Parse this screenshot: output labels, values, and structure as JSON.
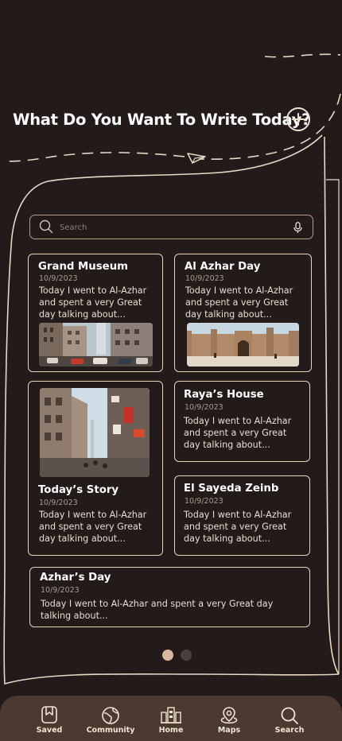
{
  "header": {
    "title": "What Do You Want To Write Today?",
    "add_icon": "plus-circle-icon"
  },
  "search": {
    "placeholder": "Search",
    "value": "",
    "icon": "search-icon",
    "mic_icon": "microphone-icon"
  },
  "cards": [
    {
      "title": "Grand Museum",
      "date": "10/9/2023",
      "text": "Today I went to Al-Azhar and spent a very Great day talking about..."
    },
    {
      "title": "Al Azhar Day",
      "date": "10/9/2023",
      "text": "Today I went to Al-Azhar and spent a very Great day talking about..."
    },
    {
      "title": "Today’s Story",
      "date": "10/9/2023",
      "text": "Today I went to Al-Azhar and spent a very Great day talking about..."
    },
    {
      "title": "Raya’s House",
      "date": "10/9/2023",
      "text": "Today I went to Al-Azhar and spent a very Great day talking about..."
    },
    {
      "title": "El Sayeda Zeinb",
      "date": "10/9/2023",
      "text": "Today I went to Al-Azhar and spent a very Great day talking about..."
    },
    {
      "title": "Azhar’s Day",
      "date": "10/9/2023",
      "text": "Today I went to Al-Azhar and spent a very Great day talking about..."
    }
  ],
  "pagination": {
    "pages": 2,
    "current": 1
  },
  "nav": {
    "items": [
      {
        "label": "Saved",
        "icon": "bookmark-icon"
      },
      {
        "label": "Community",
        "icon": "globe-icon"
      },
      {
        "label": "Home",
        "icon": "buildings-icon"
      },
      {
        "label": "Maps",
        "icon": "map-pin-icon"
      },
      {
        "label": "Search",
        "icon": "search-icon"
      }
    ]
  },
  "colors": {
    "background": "#231b19",
    "accent": "#e9d3b2",
    "nav_background": "#4a3a30",
    "active_dot": "#d9b89a"
  }
}
